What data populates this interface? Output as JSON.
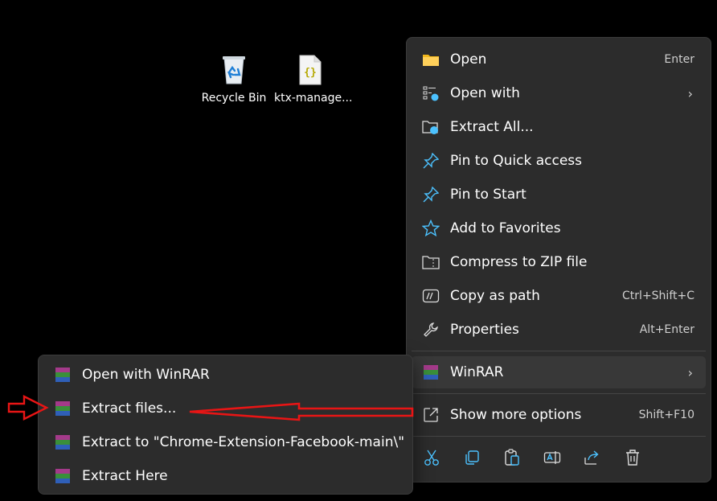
{
  "desktop": {
    "icons": [
      {
        "label": "Recycle Bin",
        "icon": "recycle-bin-icon"
      },
      {
        "label": "ktx-manage...",
        "icon": "json-file-icon"
      }
    ]
  },
  "context_menu": {
    "items": [
      {
        "label": "Open",
        "shortcut": "Enter",
        "icon": "folder-icon"
      },
      {
        "label": "Open with",
        "shortcut": "",
        "icon": "open-with-icon",
        "submenu": true
      },
      {
        "label": "Extract All...",
        "shortcut": "",
        "icon": "extract-folder-icon"
      },
      {
        "label": "Pin to Quick access",
        "shortcut": "",
        "icon": "pin-icon"
      },
      {
        "label": "Pin to Start",
        "shortcut": "",
        "icon": "pin-icon"
      },
      {
        "label": "Add to Favorites",
        "shortcut": "",
        "icon": "star-icon"
      },
      {
        "label": "Compress to ZIP file",
        "shortcut": "",
        "icon": "zip-icon"
      },
      {
        "label": "Copy as path",
        "shortcut": "Ctrl+Shift+C",
        "icon": "copy-path-icon"
      },
      {
        "label": "Properties",
        "shortcut": "Alt+Enter",
        "icon": "wrench-icon"
      }
    ],
    "winrar": {
      "label": "WinRAR",
      "icon": "winrar-icon"
    },
    "more": {
      "label": "Show more options",
      "shortcut": "Shift+F10",
      "icon": "more-options-icon"
    },
    "toolbar": [
      "cut-icon",
      "copy-icon",
      "paste-icon",
      "rename-icon",
      "share-icon",
      "delete-icon"
    ]
  },
  "winrar_submenu": {
    "items": [
      {
        "label": "Open with WinRAR"
      },
      {
        "label": "Extract files..."
      },
      {
        "label": "Extract to \"Chrome-Extension-Facebook-main\\\""
      },
      {
        "label": "Extract Here"
      }
    ]
  },
  "colors": {
    "menu_bg": "#2c2c2c",
    "accent_blue": "#4cc2ff",
    "annotation_red": "#e81515"
  }
}
